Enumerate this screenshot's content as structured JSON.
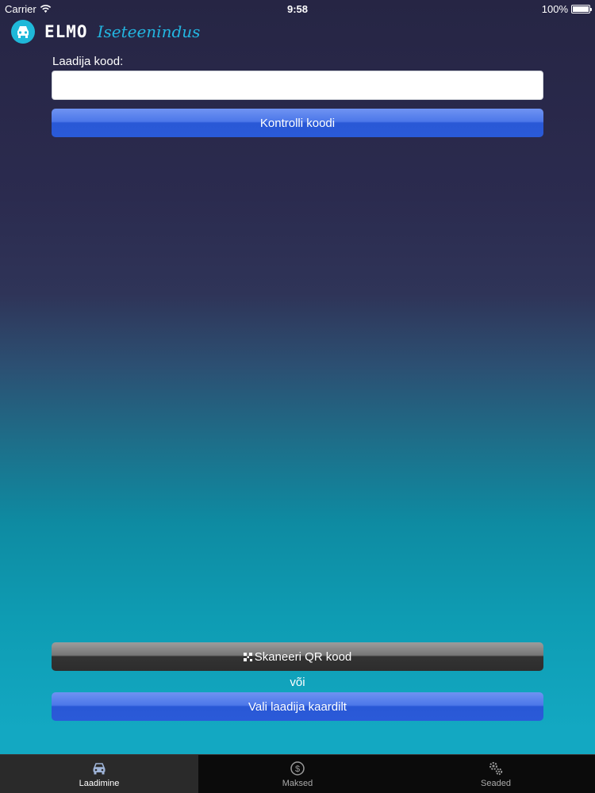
{
  "status_bar": {
    "carrier": "Carrier",
    "time": "9:58",
    "battery": "100%"
  },
  "header": {
    "brand": "ELMO",
    "subtitle": "Iseteenindus",
    "logo_icon": "car-face-logo",
    "brand_color": "#1fb8d9"
  },
  "form": {
    "label": "Laadija kood:",
    "input_value": "",
    "input_placeholder": "",
    "check_button": "Kontrolli koodi"
  },
  "actions": {
    "scan_button": "Skaneeri QR kood",
    "or_text": "või",
    "map_button": "Vali laadija kaardilt"
  },
  "tab_bar": {
    "tabs": [
      {
        "label": "Laadimine",
        "icon": "car-icon",
        "active": true
      },
      {
        "label": "Maksed",
        "icon": "dollar-icon",
        "active": false
      },
      {
        "label": "Seaded",
        "icon": "gears-icon",
        "active": false
      }
    ]
  },
  "colors": {
    "button_blue": "#2a5ad8",
    "button_dark": "#2d2d2d",
    "bg_top": "#262544",
    "bg_bottom": "#13a8c2"
  }
}
